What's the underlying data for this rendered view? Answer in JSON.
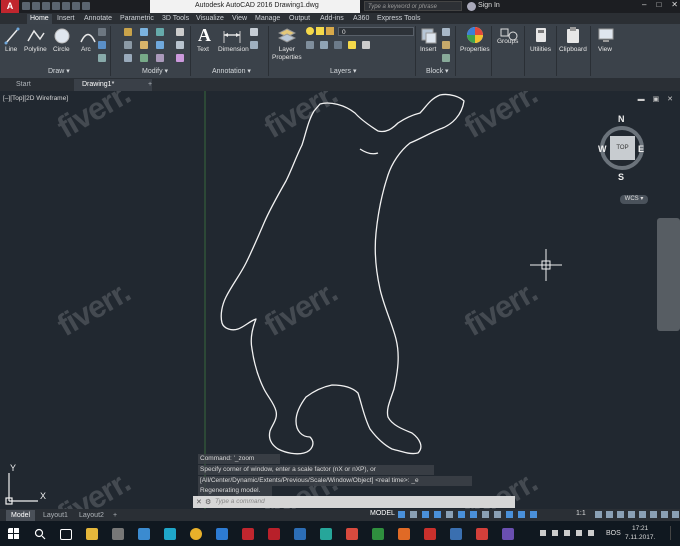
{
  "titlebar": {
    "app_logo": "A",
    "title": "Autodesk AutoCAD 2016    Drawing1.dwg",
    "search_placeholder": "Type a keyword or phrase",
    "sign_in": "Sign In",
    "controls": [
      "–",
      "□",
      "✕"
    ]
  },
  "ribbon_tabs": [
    "Home",
    "Insert",
    "Annotate",
    "Parametric",
    "3D Tools",
    "Visualize",
    "View",
    "Manage",
    "Output",
    "Add-ins",
    "A360",
    "Express Tools"
  ],
  "ribbon": {
    "draw": {
      "line": "Line",
      "polyline": "Polyline",
      "circle": "Circle",
      "arc": "Arc",
      "panel": "Draw ▾"
    },
    "modify": {
      "panel": "Modify ▾"
    },
    "annotation": {
      "text": "Text",
      "dimension": "Dimension",
      "panel": "Annotation ▾"
    },
    "layers": {
      "layer_properties": "Layer\nProperties",
      "layer_value": "0",
      "panel": "Layers ▾"
    },
    "block": {
      "insert": "Insert",
      "panel": "Block ▾"
    },
    "properties": "Properties",
    "groups": "Groups",
    "utilities": "Utilities",
    "clipboard": "Clipboard",
    "view": "View"
  },
  "file_tabs": [
    "Start",
    "Drawing1*",
    "+"
  ],
  "viewport": {
    "label": "[–][Top][2D Wireframe]",
    "controls": "▬ ▣ ✕",
    "viewcube": {
      "n": "N",
      "s": "S",
      "e": "E",
      "w": "W",
      "top": "TOP"
    },
    "wcs": "WCS ▾"
  },
  "command": {
    "history": [
      "Command: '_zoom",
      "Specify corner of window, enter a scale factor (nX or nXP), or",
      "[All/Center/Dynamic/Extents/Previous/Scale/Window/Object] <real time>: _e",
      "Regenerating model."
    ],
    "placeholder": "Type a command"
  },
  "watermark": "fiverr.",
  "layout_tabs": [
    "Model",
    "Layout1",
    "Layout2",
    "+"
  ],
  "status": {
    "model": "MODEL",
    "scale": "1:1"
  },
  "taskbar": {
    "lang": "BOS",
    "time": "17:21",
    "date": "7.11.2017."
  },
  "colors": {
    "accent": "#c0262e",
    "background": "#212830",
    "ribbon": "#3b424a",
    "ucs_y": "#ffffff"
  }
}
